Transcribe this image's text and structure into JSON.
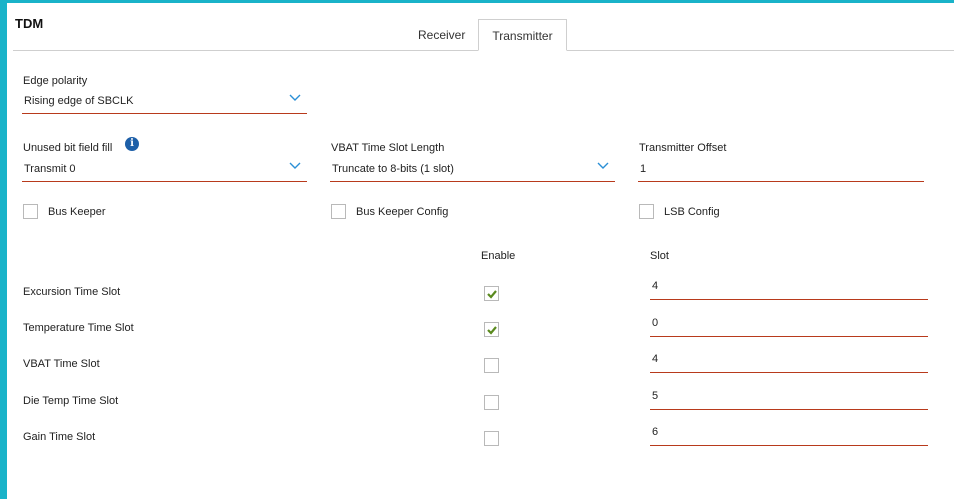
{
  "title": "TDM",
  "tabs": [
    {
      "label": "Receiver",
      "active": false
    },
    {
      "label": "Transmitter",
      "active": true
    }
  ],
  "edge_polarity": {
    "label": "Edge polarity",
    "value": "Rising edge of SBCLK"
  },
  "unused_fill": {
    "label": "Unused bit field fill",
    "value": "Transmit 0",
    "info_icon": "i"
  },
  "vbat_len": {
    "label": "VBAT Time Slot Length",
    "value": "Truncate to 8-bits (1 slot)"
  },
  "tx_offset": {
    "label": "Transmitter Offset",
    "value": "1"
  },
  "checkboxes": [
    {
      "label": "Bus Keeper",
      "checked": false
    },
    {
      "label": "Bus Keeper Config",
      "checked": false
    },
    {
      "label": "LSB Config",
      "checked": false
    }
  ],
  "table": {
    "enable_header": "Enable",
    "slot_header": "Slot",
    "rows": [
      {
        "label": "Excursion Time Slot",
        "enabled": true,
        "slot": "4"
      },
      {
        "label": "Temperature Time Slot",
        "enabled": true,
        "slot": "0"
      },
      {
        "label": "VBAT Time Slot",
        "enabled": false,
        "slot": "4"
      },
      {
        "label": "Die Temp Time Slot",
        "enabled": false,
        "slot": "5"
      },
      {
        "label": "Gain Time Slot",
        "enabled": false,
        "slot": "6"
      }
    ]
  },
  "colors": {
    "accent": "#19b3c9",
    "underline": "#b83a1c",
    "check": "#5a8a1e",
    "chevron": "#2a8fd6",
    "info": "#1d5fa8"
  }
}
